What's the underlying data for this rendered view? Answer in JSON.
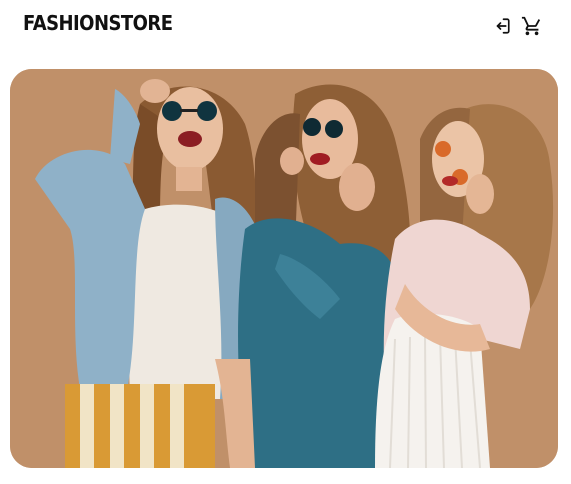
{
  "header": {
    "logo_text": "FASHIONSTORE",
    "actions": [
      {
        "name": "login-icon",
        "icon": "login"
      },
      {
        "name": "cart-icon",
        "icon": "shopping-cart"
      }
    ]
  },
  "hero": {
    "image_kind": "photo",
    "colors": {
      "backdrop": "#c09069",
      "denim_light": "#8fb1c8",
      "denim_dark": "#2e6f85",
      "hair": "#8a5a32",
      "skin": "#e9bfa0",
      "white_top": "#efe9e1",
      "pink_jacket": "#efd6d2"
    }
  }
}
